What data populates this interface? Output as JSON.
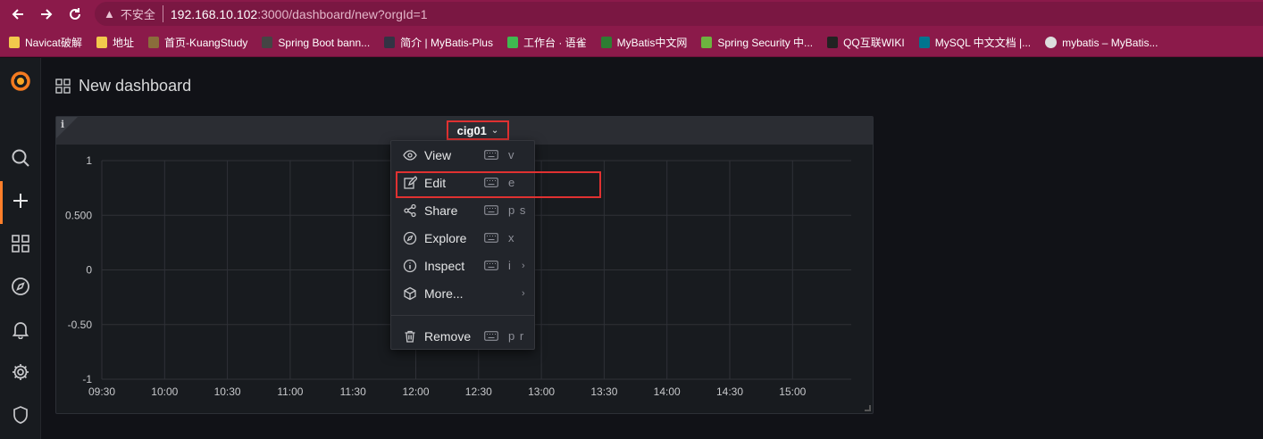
{
  "browser": {
    "url_warning": "不安全",
    "url_host": "192.168.10.102",
    "url_path": ":3000/dashboard/new?orgId=1",
    "bookmarks": [
      {
        "label": "Navicat破解",
        "icon": "folder-icon",
        "color": "#f2c94c"
      },
      {
        "label": "地址",
        "icon": "folder-icon",
        "color": "#f2c94c"
      },
      {
        "label": "首页-KuangStudy",
        "icon": "site-icon",
        "color": "#8a6d3b"
      },
      {
        "label": "Spring Boot bann...",
        "icon": "site-icon",
        "color": "#444"
      },
      {
        "label": "简介 | MyBatis-Plus",
        "icon": "site-icon",
        "color": "#334"
      },
      {
        "label": "工作台 · 语雀",
        "icon": "site-icon",
        "color": "#3fb950"
      },
      {
        "label": "MyBatis中文网",
        "icon": "site-icon",
        "color": "#2e7d32"
      },
      {
        "label": "Spring Security 中...",
        "icon": "site-icon",
        "color": "#6db33f"
      },
      {
        "label": "QQ互联WIKI",
        "icon": "site-icon",
        "color": "#222"
      },
      {
        "label": "MySQL 中文文档 |...",
        "icon": "site-icon",
        "color": "#00758f"
      },
      {
        "label": "mybatis – MyBatis...",
        "icon": "globe-icon",
        "color": "#ddd"
      }
    ]
  },
  "header": {
    "title": "New dashboard"
  },
  "panel": {
    "info": "i",
    "title": "cig01",
    "chevron": "⌄"
  },
  "chart_data": {
    "type": "line",
    "x_ticks": [
      "09:30",
      "10:00",
      "10:30",
      "11:00",
      "11:30",
      "12:00",
      "12:30",
      "13:00",
      "13:30",
      "14:00",
      "14:30",
      "15:00"
    ],
    "y_ticks": [
      "1",
      "0.500",
      "0",
      "-0.50",
      "-1"
    ],
    "ylim": [
      -1,
      1
    ],
    "series": [],
    "grid": true,
    "legend": "none"
  },
  "menu": {
    "items": [
      {
        "label": "View",
        "icon": "eye-icon",
        "shortcut": "v",
        "arrow": ""
      },
      {
        "label": "Edit",
        "icon": "edit-icon",
        "shortcut": "e",
        "arrow": ""
      },
      {
        "label": "Share",
        "icon": "share-icon",
        "shortcut": "p s",
        "arrow": ""
      },
      {
        "label": "Explore",
        "icon": "compass-icon",
        "shortcut": "x",
        "arrow": ""
      },
      {
        "label": "Inspect",
        "icon": "info-circle-icon",
        "shortcut": "i",
        "arrow": "›"
      },
      {
        "label": "More...",
        "icon": "cube-icon",
        "shortcut": "",
        "arrow": "›"
      },
      {
        "label": "Remove",
        "icon": "trash-icon",
        "shortcut": "p r",
        "arrow": ""
      }
    ]
  },
  "colors": {
    "browser_bar": "#8b1a4a",
    "accent": "#ff7f2a",
    "highlight": "#e03131"
  }
}
